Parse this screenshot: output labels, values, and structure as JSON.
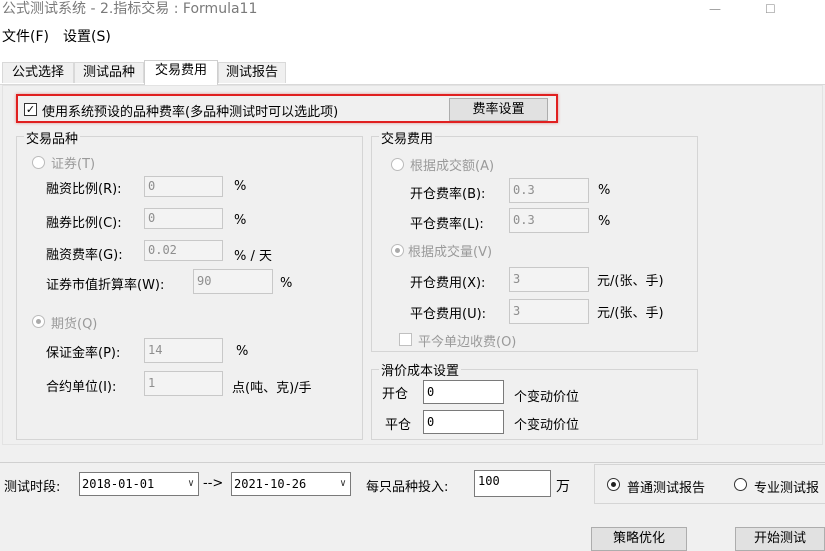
{
  "window": {
    "title": "公式测试系统 - 2.指标交易 : Formula11",
    "min_glyph": "—",
    "max_glyph": "☐"
  },
  "menu": [
    "文件(F)",
    "设置(S)"
  ],
  "tabs": [
    "公式选择",
    "测试品种",
    "交易费用",
    "测试报告"
  ],
  "active_tab": "交易费用",
  "preset": {
    "checked": true,
    "check_glyph": "✓",
    "label": "使用系统预设的品种费率(多品种测试时可以选此项)",
    "button": "费率设置"
  },
  "instrument": {
    "title": "交易品种",
    "stock": {
      "label": "证券(T)",
      "selected": false,
      "margin_ratio": {
        "label": "融资比例(R):",
        "value": "0",
        "unit": "%"
      },
      "short_ratio": {
        "label": "融券比例(C):",
        "value": "0",
        "unit": "%"
      },
      "margin_rate": {
        "label": "融资费率(G):",
        "value": "0.02",
        "unit": "% / 天"
      },
      "discount": {
        "label": "证券市值折算率(W):",
        "value": "90",
        "unit": "%"
      }
    },
    "futures": {
      "label": "期货(Q)",
      "selected": true,
      "deposit": {
        "label": "保证金率(P):",
        "value": "14",
        "unit": "%"
      },
      "contract_unit": {
        "label": "合约单位(I):",
        "value": "1",
        "unit": "点(吨、克)/手"
      }
    }
  },
  "fees": {
    "title": "交易费用",
    "by_amount": {
      "label": "根据成交额(A)",
      "selected": false,
      "open": {
        "label": "开仓费率(B):",
        "value": "0.3",
        "unit": "%"
      },
      "close": {
        "label": "平仓费率(L):",
        "value": "0.3",
        "unit": "%"
      }
    },
    "by_volume": {
      "label": "根据成交量(V)",
      "selected": true,
      "open": {
        "label": "开仓费用(X):",
        "value": "3",
        "unit": "元/(张、手)"
      },
      "close": {
        "label": "平仓费用(U):",
        "value": "3",
        "unit": "元/(张、手)"
      }
    },
    "close_today": {
      "label": "平今单边收费(O)",
      "checked": false
    }
  },
  "slippage": {
    "title": "滑价成本设置",
    "open": {
      "label": "开仓",
      "value": "0",
      "unit": "个变动价位"
    },
    "close": {
      "label": "平仓",
      "value": "0",
      "unit": "个变动价位"
    }
  },
  "period": {
    "label": "测试时段:",
    "start": "2018-01-01",
    "arrow": "-->",
    "end": "2021-10-26",
    "dropdown_glyph": "∨"
  },
  "investment": {
    "label": "每只品种投入:",
    "value": "100",
    "unit": "万"
  },
  "report_type": {
    "normal": "普通测试报告",
    "pro": "专业测试报",
    "selected": "normal"
  },
  "buttons": {
    "optimize": "策略优化",
    "start": "开始测试"
  }
}
